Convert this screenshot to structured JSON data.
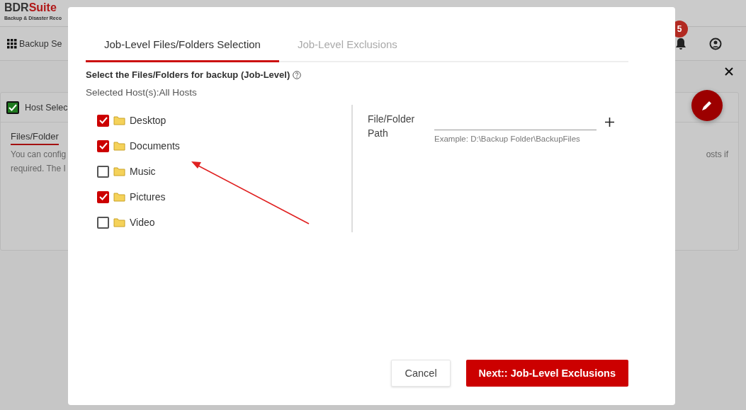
{
  "background": {
    "logo": {
      "brand_dark": "BDR",
      "brand_red": "Suite",
      "tagline": "Backup & Disaster Reco"
    },
    "toolbar": {
      "title": "Backup Se",
      "notifications": "5"
    },
    "card": {
      "step": "Host Selec",
      "step_done": true,
      "section": "Files/Folder",
      "line_1": "You can config",
      "line_1_end": "osts if",
      "line_2": "required. The I"
    }
  },
  "dialog": {
    "tabs": [
      {
        "label": "Job-Level Files/Folders Selection",
        "selected": true
      },
      {
        "label": "Job-Level Exclusions",
        "selected": false
      }
    ],
    "heading": "Select the Files/Folders for backup (Job-Level)",
    "hosts": "Selected Host(s):All Hosts",
    "folders": [
      {
        "name": "Desktop",
        "checked": true
      },
      {
        "name": "Documents",
        "checked": true
      },
      {
        "name": "Music",
        "checked": false
      },
      {
        "name": "Pictures",
        "checked": true
      },
      {
        "name": "Video",
        "checked": false
      }
    ],
    "path": {
      "label": "File/Folder Path",
      "hint": "Example: D:\\Backup Folder\\BackupFiles"
    },
    "buttons": [
      {
        "label": "Cancel",
        "kind": "secondary"
      },
      {
        "label": "Next:: Job-Level Exclusions",
        "kind": "primary"
      }
    ]
  }
}
